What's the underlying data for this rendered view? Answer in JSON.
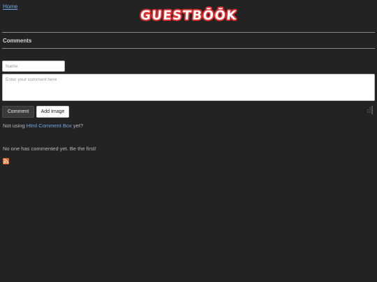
{
  "header": {
    "home_link": "Home",
    "logo_text": "GUESTBŌŌK"
  },
  "section": {
    "title": "Comments"
  },
  "form": {
    "name_placeholder": "Name",
    "comment_placeholder": "Enter your comment here",
    "comment_button": "Comment",
    "add_image_button": "Add Image"
  },
  "promo": {
    "prefix": "Not using",
    "link": "Html Comment Box",
    "suffix": "yet?"
  },
  "empty_message": "No one has commented yet. Be the first!",
  "colors": {
    "background": "#232323",
    "link": "#6fa8e6",
    "logo_outline": "#e03030",
    "rss": "#e56c2b"
  },
  "icons": {
    "rss": "rss-feed-icon",
    "grip": "drag-grip-icon"
  }
}
